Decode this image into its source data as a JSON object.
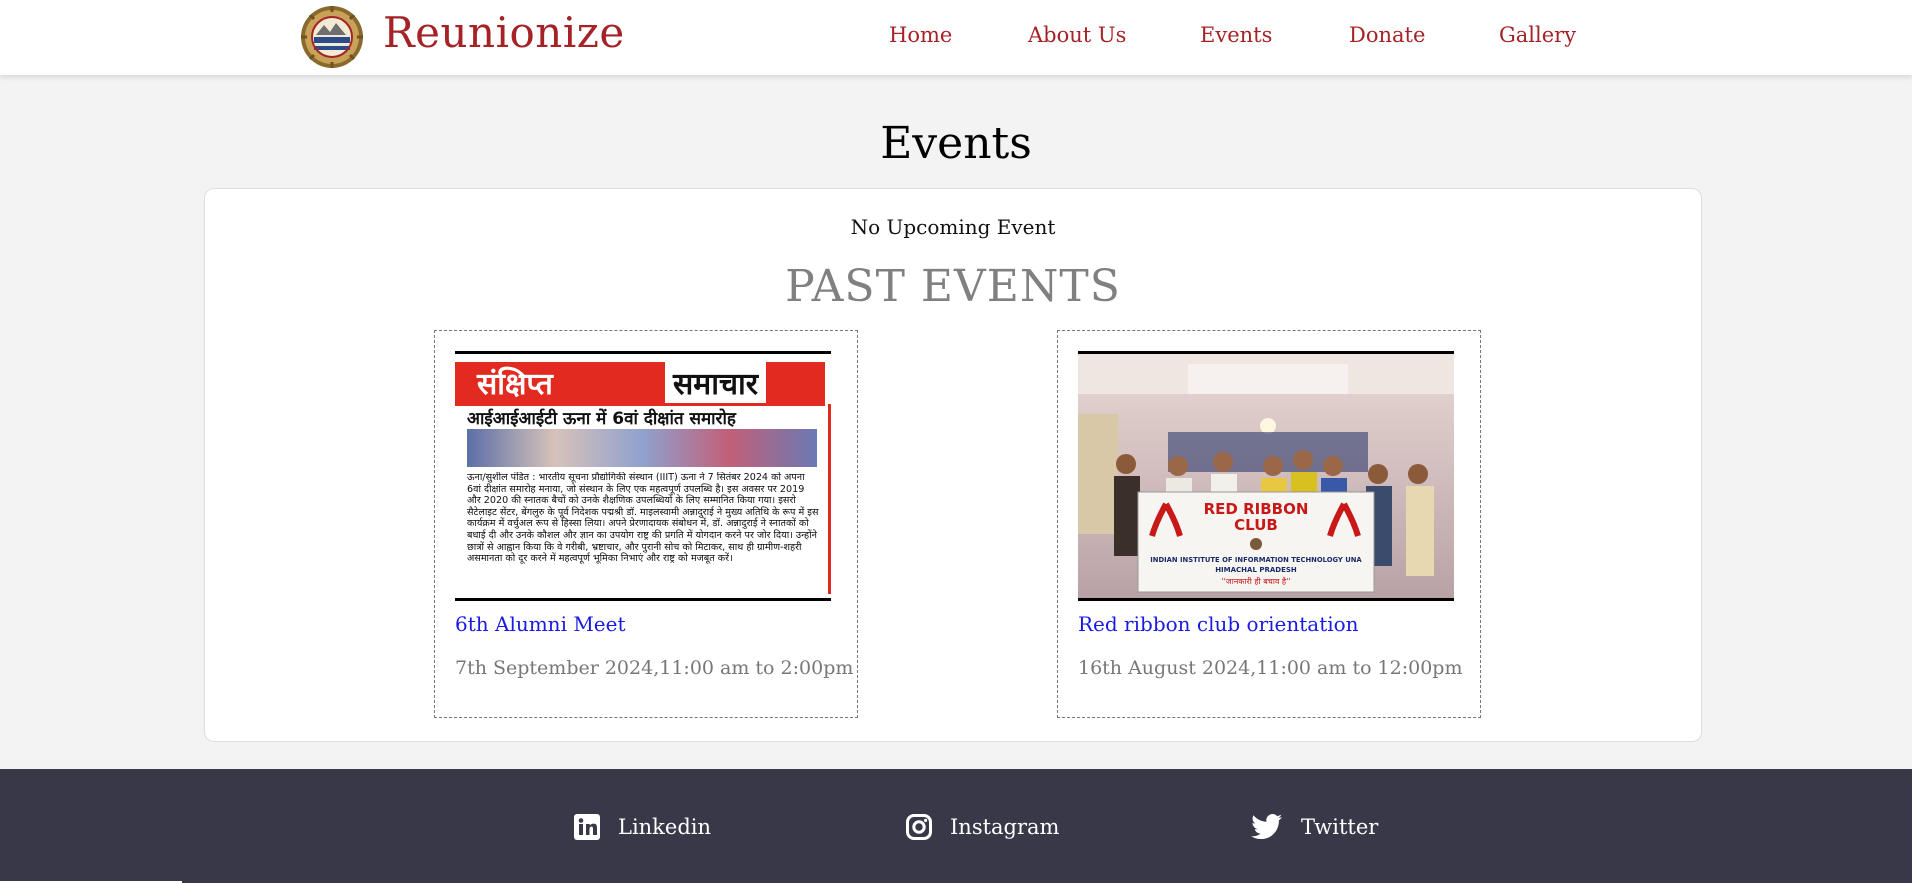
{
  "header": {
    "brand": "Reunionize",
    "nav": [
      "Home",
      "About Us",
      "Events",
      "Donate",
      "Gallery"
    ]
  },
  "page_title": "Events",
  "upcoming_text": "No Upcoming Event",
  "past_heading": "PAST EVENTS",
  "events": [
    {
      "name": "6th Alumni Meet",
      "date": "7th September 2024,11:00 am to 2:00pm",
      "clipping": {
        "title_left": "संक्षिप्त",
        "title_right": "समाचार",
        "subtitle": "आईआईआईटी ऊना में 6वां दीक्षांत समारोह",
        "body": "ऊना/सुशील पंडित : भारतीय सूचना प्रौद्योगिकी संस्थान (IIIT) ऊना ने 7 सितंबर 2024 को अपना 6वां दीक्षांत समारोह मनाया, जो संस्थान के लिए एक महत्वपूर्ण उपलब्धि है। इस अवसर पर 2019 और 2020 की स्नातक बैचों को उनके शैक्षणिक उपलब्धियों के लिए सम्मानित किया गया। इसरो सैटेलाइट सेंटर, बेंगलुरु के पूर्व निदेशक पद्मश्री डॉ. माइलस्वामी अन्नादुराई ने मुख्य अतिथि के रूप में इस कार्यक्रम में वर्चुअल रूप से हिस्सा लिया। अपने प्रेरणादायक संबोधन में, डॉ. अन्नादुराई ने स्नातकों को बधाई दी और उनके कौशल और ज्ञान का उपयोग राष्ट्र की प्रगति में योगदान करने पर जोर दिया। उन्होंने छात्रों से आह्वान किया कि वे गरीबी, भ्रष्टाचार, और पुरानी सोच को मिटाकर, साथ ही ग्रामीण-शहरी असमानता को दूर करने में महत्वपूर्ण भूमिका निभाएं और राष्ट्र को मजबूत करें।"
      }
    },
    {
      "name": "Red ribbon club orientation",
      "date": "16th August 2024,11:00 am to 12:00pm",
      "banner": {
        "title": "RED RIBBON",
        "title2": "CLUB",
        "line1": "INDIAN INSTITUTE OF INFORMATION TECHNOLOGY UNA",
        "line2": "HIMACHAL PRADESH",
        "line3": "''जानकारी ही बचाव है''"
      }
    }
  ],
  "footer": {
    "links": [
      {
        "label": "Linkedin",
        "icon": "linkedin-icon"
      },
      {
        "label": "Instagram",
        "icon": "instagram-icon"
      },
      {
        "label": "Twitter",
        "icon": "twitter-icon"
      }
    ]
  },
  "colors": {
    "brand": "#a52326",
    "link": "#1a1ae6",
    "footer_bg": "#383849",
    "page_bg": "#f3f3f3"
  }
}
